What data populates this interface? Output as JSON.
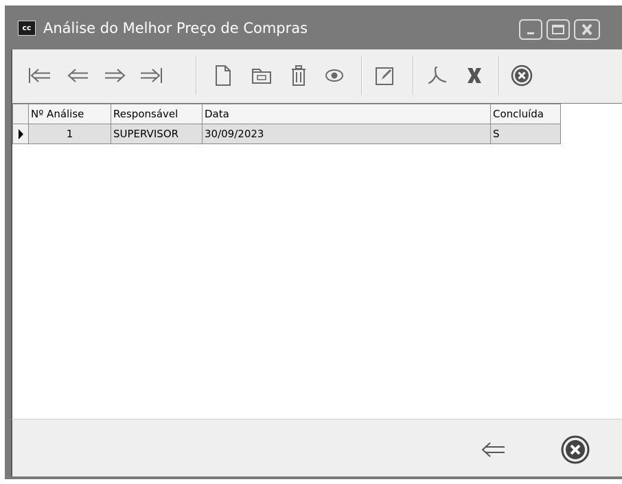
{
  "window": {
    "title": "Análise do Melhor Preço de Compras",
    "app_icon_text": "cc"
  },
  "toolbar": {
    "buttons": [
      {
        "name": "first-record",
        "icon": "first-arrow-icon"
      },
      {
        "name": "previous-record",
        "icon": "left-arrow-icon"
      },
      {
        "name": "next-record",
        "icon": "right-arrow-icon"
      },
      {
        "name": "last-record",
        "icon": "last-arrow-icon"
      },
      {
        "name": "new-record",
        "icon": "new-document-icon"
      },
      {
        "name": "open-record",
        "icon": "folder-icon"
      },
      {
        "name": "delete-record",
        "icon": "trash-icon"
      },
      {
        "name": "view-record",
        "icon": "eye-icon"
      },
      {
        "name": "edit-record",
        "icon": "edit-icon"
      },
      {
        "name": "export-pdf",
        "icon": "pdf-icon"
      },
      {
        "name": "export-excel",
        "icon": "excel-icon"
      },
      {
        "name": "close",
        "icon": "close-circle-icon"
      }
    ]
  },
  "grid": {
    "columns": [
      "Nº Análise",
      "Responsável",
      "Data",
      "Concluída"
    ],
    "rows": [
      {
        "numero": "1",
        "responsavel": "SUPERVISOR",
        "data": "30/09/2023",
        "concluida": "S"
      }
    ]
  },
  "footer": {
    "buttons": [
      {
        "name": "back",
        "icon": "back-arrow-icon"
      },
      {
        "name": "close",
        "icon": "close-circle-icon"
      }
    ]
  }
}
